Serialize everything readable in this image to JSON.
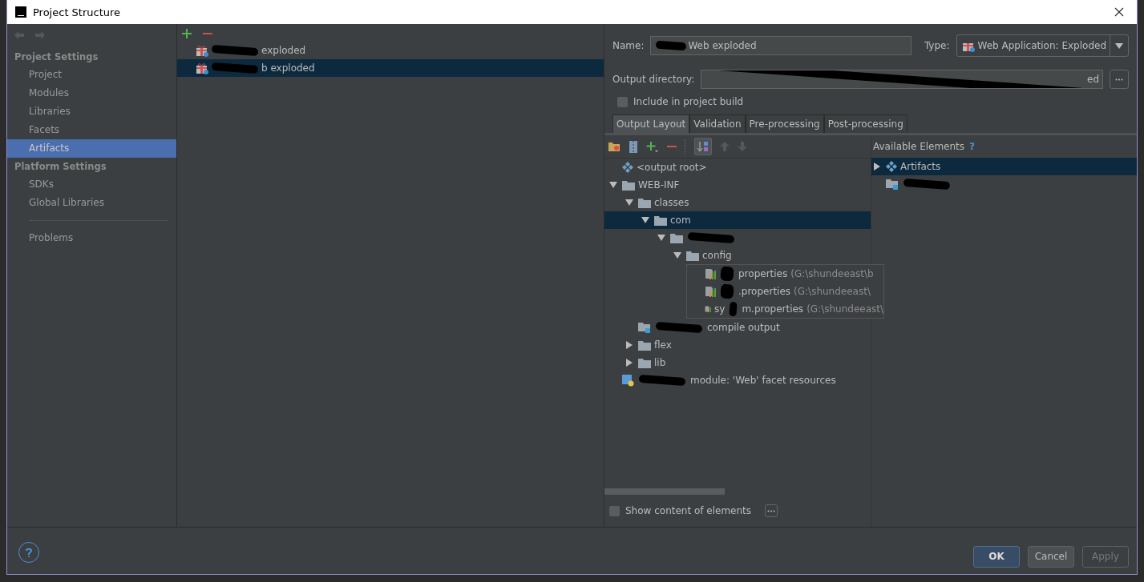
{
  "window": {
    "title": "Project Structure"
  },
  "sidebar": {
    "sections": [
      {
        "heading": "Project Settings",
        "items": [
          {
            "label": "Project",
            "selected": false
          },
          {
            "label": "Modules",
            "selected": false
          },
          {
            "label": "Libraries",
            "selected": false
          },
          {
            "label": "Facets",
            "selected": false
          },
          {
            "label": "Artifacts",
            "selected": true
          }
        ]
      },
      {
        "heading": "Platform Settings",
        "items": [
          {
            "label": "SDKs",
            "selected": false
          },
          {
            "label": "Global Libraries",
            "selected": false
          }
        ]
      }
    ],
    "footer_items": [
      {
        "label": "Problems",
        "selected": false
      }
    ]
  },
  "artifacts": [
    {
      "label": "exploded",
      "selected": false
    },
    {
      "label": "b exploded",
      "selected": true
    }
  ],
  "name_field": {
    "label": "Name:",
    "value": "Web exploded"
  },
  "type_field": {
    "label": "Type:",
    "value": "Web Application: Exploded"
  },
  "output_directory": {
    "label": "Output directory:",
    "value": "ed"
  },
  "include_in_build": {
    "label": "Include in project build",
    "checked": false
  },
  "tabs": [
    {
      "label": "Output Layout",
      "selected": true
    },
    {
      "label": "Validation",
      "selected": false
    },
    {
      "label": "Pre-processing",
      "selected": false
    },
    {
      "label": "Post-processing",
      "selected": false
    }
  ],
  "layout_tree": [
    {
      "kind": "root",
      "label": "<output root>",
      "selected": false
    },
    {
      "kind": "folder",
      "label": "WEB-INF",
      "expanded": true,
      "selected": false,
      "children": [
        {
          "kind": "folder",
          "label": "classes",
          "expanded": true,
          "selected": false,
          "children": [
            {
              "kind": "folder",
              "label": "com",
              "expanded": true,
              "selected": true,
              "children": [
                {
                  "kind": "folder",
                  "expanded": true,
                  "selected": false,
                  "children": [
                    {
                      "kind": "folder",
                      "label": "config",
                      "expanded": true,
                      "selected": false,
                      "children": [
                        {
                          "kind": "file",
                          "label": "properties",
                          "hint": "(G:\\shundeeast\\b",
                          "selected": false
                        },
                        {
                          "kind": "file",
                          "label": ".properties",
                          "hint": "(G:\\shundeeast\\",
                          "selected": false
                        },
                        {
                          "kind": "file",
                          "prefix": "sy",
                          "label": "m.properties",
                          "hint": "(G:\\shundeeast\\",
                          "selected": false
                        }
                      ]
                    }
                  ]
                }
              ]
            }
          ]
        },
        {
          "kind": "module",
          "label": "compile output",
          "selected": false
        },
        {
          "kind": "folder",
          "label": "flex",
          "expanded": false,
          "selected": false
        },
        {
          "kind": "folder",
          "label": "lib",
          "expanded": false,
          "selected": false
        }
      ]
    },
    {
      "kind": "facet",
      "label": "module: 'Web' facet resources",
      "selected": false
    }
  ],
  "available_elements": {
    "title": "Available Elements",
    "help": "?",
    "items": [
      {
        "kind": "artifacts",
        "label": "Artifacts",
        "expanded": false,
        "selected": true
      },
      {
        "kind": "module",
        "selected": false
      }
    ]
  },
  "show_content": {
    "label": "Show content of elements",
    "checked": false
  },
  "buttons": [
    {
      "label": "OK",
      "kind": "default",
      "disabled": false
    },
    {
      "label": "Cancel",
      "kind": "normal",
      "disabled": false
    },
    {
      "label": "Apply",
      "kind": "normal",
      "disabled": true
    }
  ]
}
